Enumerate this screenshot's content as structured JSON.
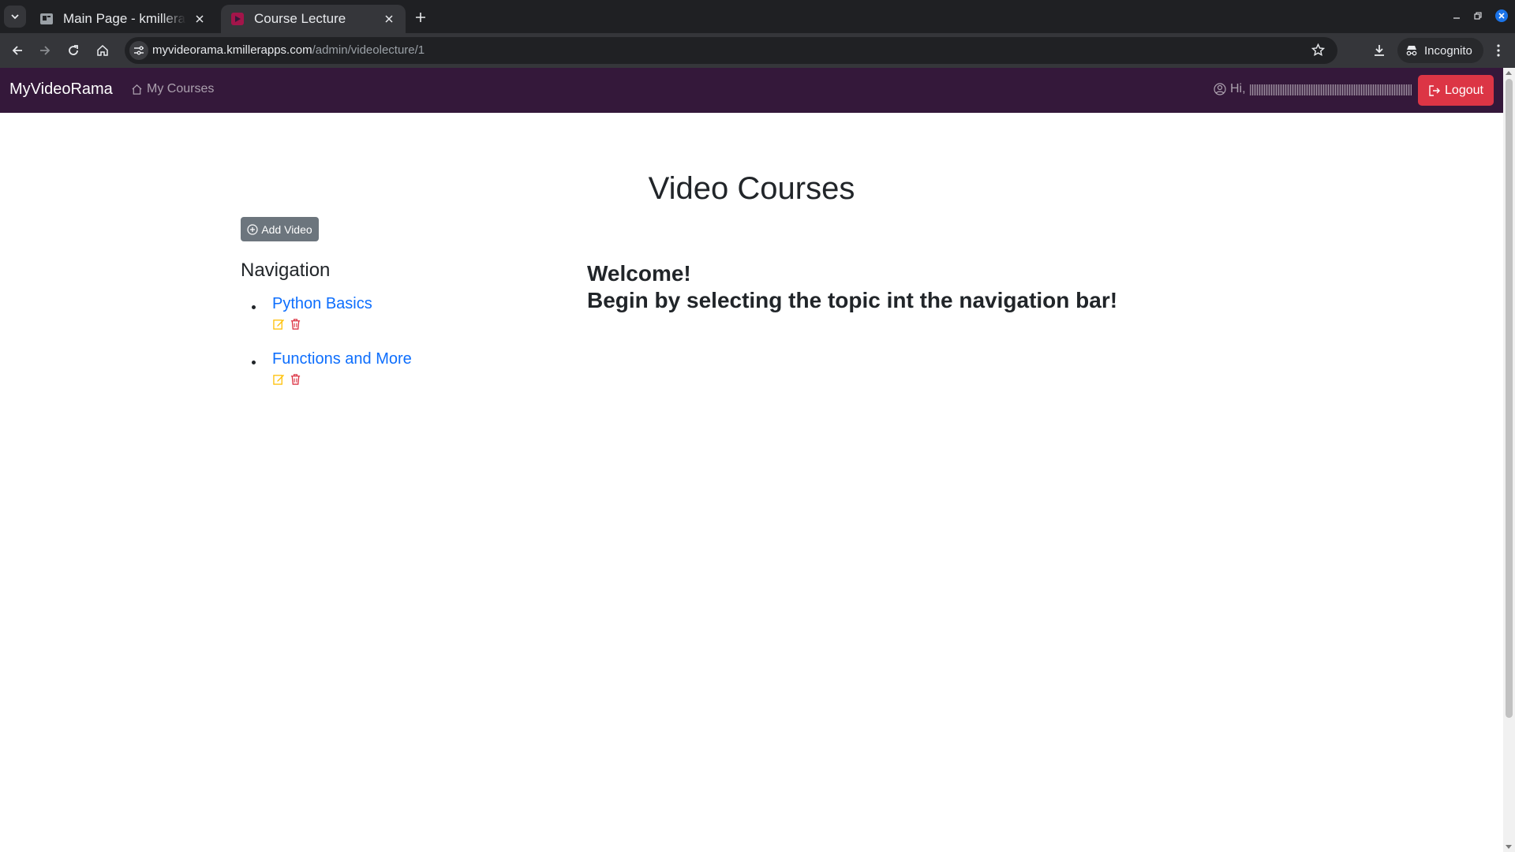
{
  "browser": {
    "tabs": [
      {
        "title": "Main Page - kmillerapps",
        "active": false
      },
      {
        "title": "Course Lecture",
        "active": true
      }
    ],
    "url_host": "myvideorama.kmillerapps.com",
    "url_path": "/admin/videolecture/1",
    "incognito_label": "Incognito",
    "icons": [
      "tab-search-icon",
      "close-icon",
      "new-tab-icon",
      "minimize-icon",
      "restore-icon",
      "close-window-icon",
      "back-icon",
      "forward-icon",
      "reload-icon",
      "home-icon",
      "site-settings-icon",
      "star-icon",
      "download-icon",
      "incognito-icon",
      "more-icon"
    ]
  },
  "navbar": {
    "brand": "MyVideoRama",
    "my_courses": "My Courses",
    "greeting": "Hi,",
    "logout": "Logout",
    "colors": {
      "background": "#34183a",
      "logout": "#dc3545"
    }
  },
  "main": {
    "title": "Video Courses",
    "add_video": "Add Video",
    "navigation_heading": "Navigation",
    "topics": [
      {
        "label": "Python Basics"
      },
      {
        "label": "Functions and More"
      }
    ],
    "welcome_line1": "Welcome!",
    "welcome_line2": "Begin by selecting the topic int the navigation bar!",
    "colors": {
      "link": "#0d6efd",
      "edit": "#ffc107",
      "delete": "#dc3545",
      "button": "#6c757d"
    }
  }
}
